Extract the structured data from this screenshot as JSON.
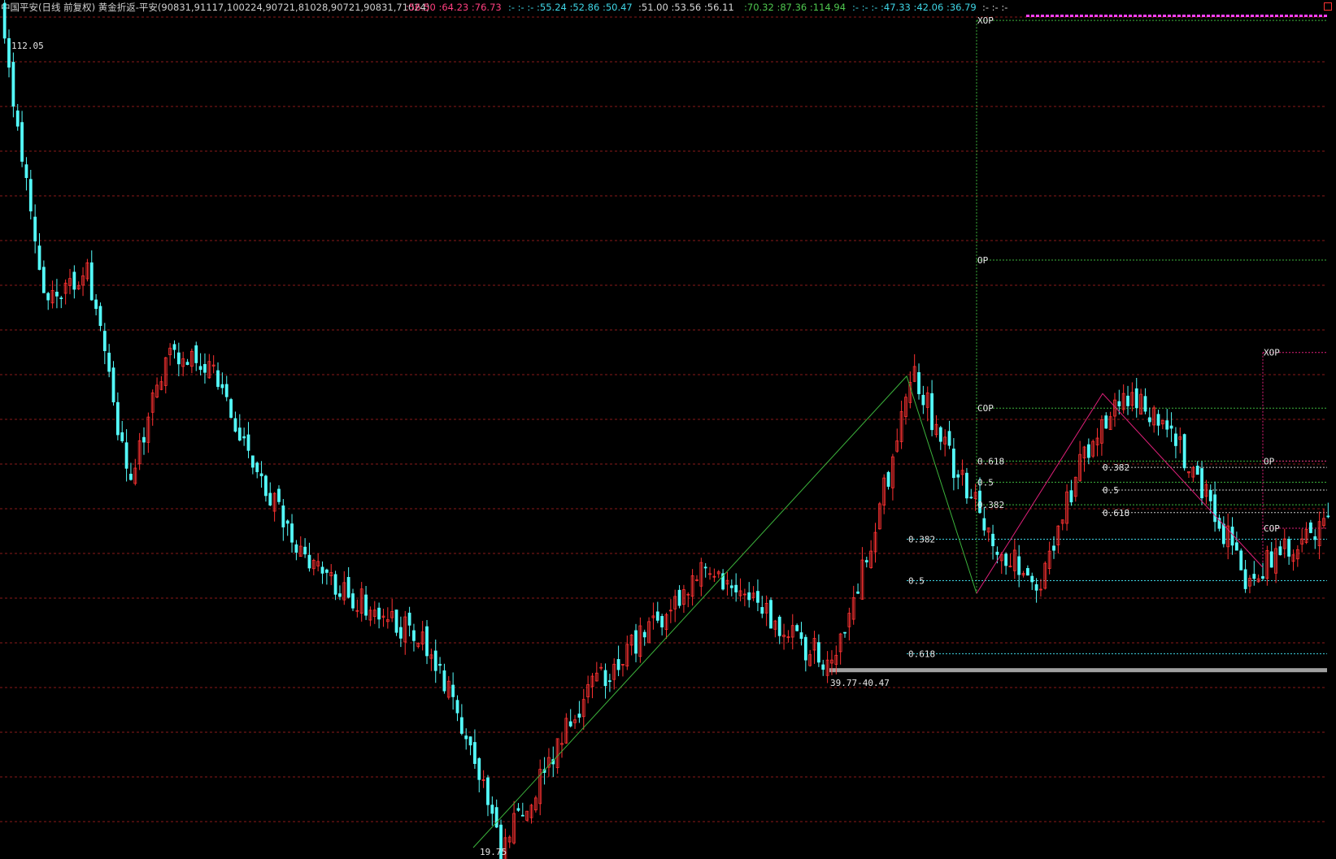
{
  "header": {
    "title": "中国平安(日线 前复权) 黄金折返-平安(90831,91117,100224,90721,81028,90721,90831,71024)",
    "groups": [
      {
        "text": ":56.50 :64.23 :76.73",
        "color": "#ff3f7f"
      },
      {
        "text": ":- :- :- :55.24 :52.86 :50.47",
        "color": "#3fd6e6"
      },
      {
        "text": ":51.00 :53.56 :56.11",
        "color": "#d8d8d8"
      },
      {
        "text": ":70.32 :87.36 :114.94",
        "color": "#4fc84f"
      },
      {
        "text": ":- :- :- :47.33 :42.06 :36.79",
        "color": "#3fd6e6"
      },
      {
        "text": ":- :- :-",
        "color": "#d8d8d8"
      }
    ],
    "corner_icon": "close-box-icon"
  },
  "colors": {
    "background": "#000000",
    "up": "#ff3232",
    "down": "#54fcfc",
    "grid": "#8a1a1a",
    "green_level": "#3cb43c",
    "magenta_level": "#e0207a",
    "white_level": "#c8c8c8",
    "cyan_level": "#3fd6e6",
    "support_bar": "#a0a0a0",
    "xop_markers": "#ff40ff"
  },
  "chart_data": {
    "type": "candlestick",
    "y_axis": "price",
    "ylim": [
      18.8,
      113.5
    ],
    "annotations": {
      "high_label": "112.05",
      "low_label": "19.75",
      "support_label": "39.77-40.47"
    },
    "swing_price_points": [
      112.05,
      83,
      86,
      62,
      77.5,
      75,
      64,
      55,
      50,
      47,
      44,
      35,
      19.75,
      28,
      37,
      42,
      47,
      52,
      48,
      44,
      41,
      56,
      74,
      63,
      55,
      49,
      64,
      72,
      69,
      61,
      51,
      54,
      57
    ],
    "zigzag_green": [
      19.75,
      74.0,
      49.0
    ],
    "zigzag_magenta": [
      49.0,
      72.0,
      52.0
    ],
    "support_zone": [
      39.77,
      40.47
    ],
    "fib_levels": {
      "green": [
        {
          "label": "XOP",
          "value": 114.94
        },
        {
          "label": "OP",
          "value": 87.36
        },
        {
          "label": "COP",
          "value": 70.32
        },
        {
          "label": "0.618",
          "value": 64.23
        },
        {
          "label": "0.5",
          "value": 61.8
        },
        {
          "label": "0.382",
          "value": 59.2
        }
      ],
      "cyan": [
        {
          "label": "0.382",
          "value": 55.24
        },
        {
          "label": "0.5",
          "value": 50.47
        },
        {
          "label": "0.618",
          "value": 42.06
        }
      ],
      "magenta": [
        {
          "label": "XOP",
          "value": 76.73
        },
        {
          "label": "OP",
          "value": 64.23
        },
        {
          "label": "COP",
          "value": 56.5
        }
      ],
      "white": [
        {
          "label": "0.382",
          "value": 63.5
        },
        {
          "label": "0.5",
          "value": 60.9
        },
        {
          "label": "0.618",
          "value": 58.3
        }
      ]
    }
  }
}
